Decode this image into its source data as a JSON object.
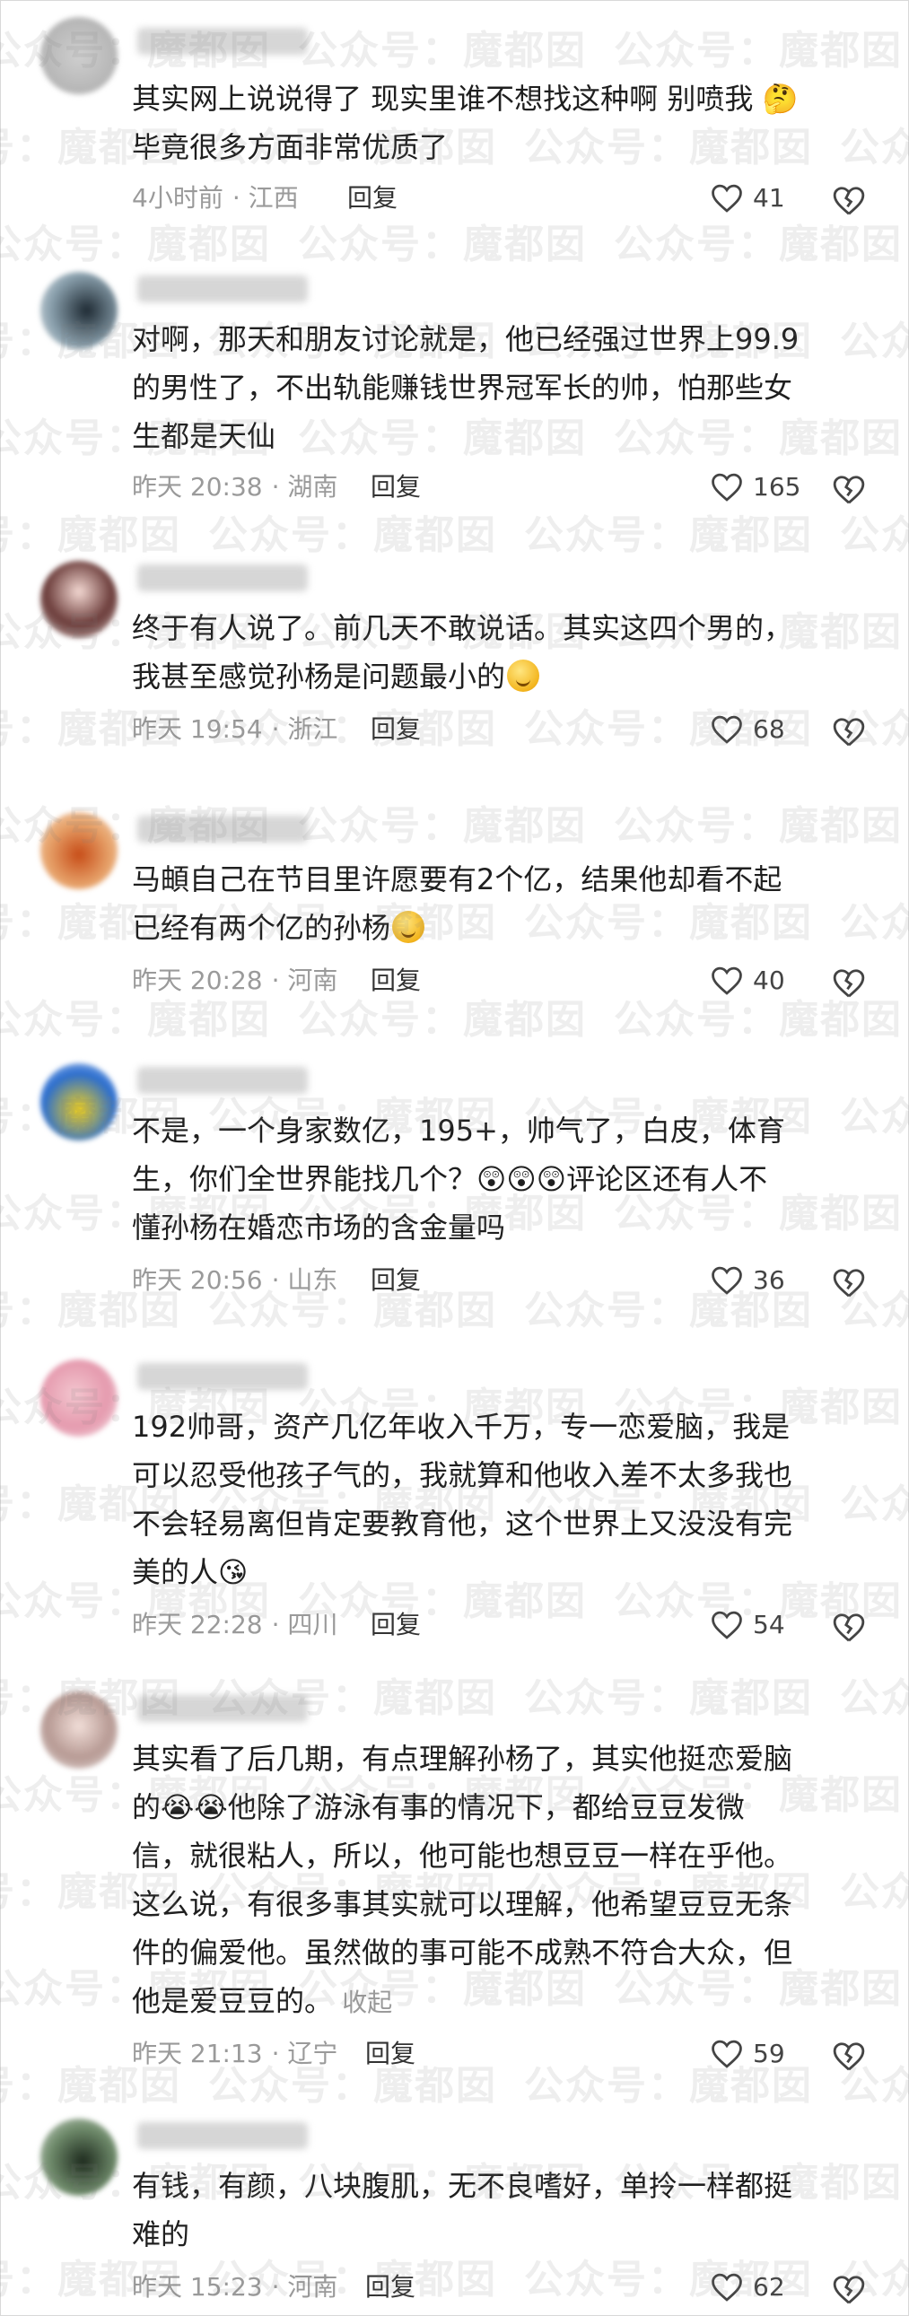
{
  "comments": [
    {
      "text": "其实网上说说得了 现实里谁不想找这种啊 别喷我 🤔\n毕竟很多方面非常优质了",
      "time": "4小时前",
      "location": "· 江西",
      "reply": "回复",
      "likes": "41"
    },
    {
      "text": "对啊，那天和朋友讨论就是，他已经强过世界上99.9\n的男性了，不出轨能赚钱世界冠军长的帅，怕那些女\n生都是天仙",
      "time": "昨天 20:38",
      "location": "· 湖南",
      "reply": "回复",
      "likes": "165"
    },
    {
      "text": "终于有人说了。前几天不敢说话。其实这四个男的，\n我甚至感觉孙杨是问题最小的",
      "time": "昨天 19:54",
      "location": "· 浙江",
      "reply": "回复",
      "likes": "68"
    },
    {
      "text": "马頔自己在节目里许愿要有2个亿，结果他却看不起\n已经有两个亿的孙杨",
      "time": "昨天 20:28",
      "location": "· 河南",
      "reply": "回复",
      "likes": "40"
    },
    {
      "text": "不是，一个身家数亿，195+，帅气了，白皮，体育\n生，你们全世界能找几个？😲😲😲评论区还有人不\n懂孙杨在婚恋市场的含金量吗",
      "time": "昨天 20:56",
      "location": "· 山东",
      "reply": "回复",
      "likes": "36"
    },
    {
      "text": "192帅哥，资产几亿年收入千万，专一恋爱脑，我是\n可以忍受他孩子气的，我就算和他收入差不太多我也\n不会轻易离但肯定要教育他，这个世界上又没没有完\n美的人😘",
      "time": "昨天 22:28",
      "location": "· 四川",
      "reply": "回复",
      "likes": "54"
    },
    {
      "text": "其实看了后几期，有点理解孙杨了，其实他挺恋爱脑\n的😭😭他除了游泳有事的情况下，都给豆豆发微\n信，就很粘人，所以，他可能也想豆豆一样在乎他。\n这么说，有很多事其实就可以理解，他希望豆豆无条\n件的偏爱他。虽然做的事可能不成熟不符合大众，但\n他是爱豆豆的。",
      "collapse": "收起",
      "time": "昨天 21:13",
      "location": "· 辽宁",
      "reply": "回复",
      "likes": "59"
    },
    {
      "text": "有钱，有颜，八块腹肌，无不良嗜好，单拎一样都挺\n难的",
      "time": "昨天 15:23",
      "location": "· 河南",
      "reply": "回复",
      "likes": "62"
    }
  ],
  "watermark": "公众号：魔都囡",
  "colors": {
    "meta": "#9a9a9a",
    "text": "#1f1f1f",
    "icon": "#444444"
  }
}
